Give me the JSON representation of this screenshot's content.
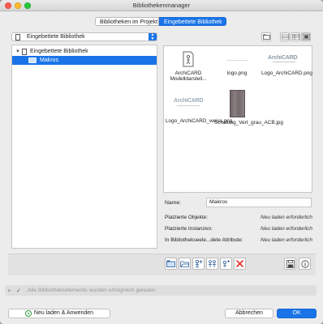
{
  "window": {
    "title": "Bibliothekenmanager"
  },
  "tabs": [
    {
      "label": "Bibliotheken im Projekt",
      "active": false
    },
    {
      "label": "Eingebettete Bibliothek",
      "active": true
    }
  ],
  "library_select": {
    "value": "Eingebettete Bibliothek"
  },
  "tree": {
    "items": [
      {
        "label": "Eingebettete Bibliothek",
        "expanded": true,
        "selected": false
      },
      {
        "label": "Makros",
        "selected": true
      }
    ]
  },
  "files": [
    {
      "label": "ArchiCARD Modelldarstell...",
      "icon": "gsm-object-icon"
    },
    {
      "label": "logo.png",
      "icon": "image-thumbnail"
    },
    {
      "label": "Logo_ArchiCARD.png",
      "icon": "image-thumbnail",
      "brand_text": "ArchiCARD"
    },
    {
      "label": "Logo_ArchiCARD_weiss.png",
      "icon": "image-thumbnail",
      "brand_text": "ArchiCARD"
    },
    {
      "label": "Schalung_Vert_grau_ACB.jpg",
      "icon": "texture-thumbnail"
    }
  ],
  "properties": {
    "name_label": "Name:",
    "name_value": "Makros",
    "rows": [
      {
        "key": "Platzierte Objekte:",
        "value": "Neu laden erforderlich"
      },
      {
        "key": "Platzierte Instanzen:",
        "value": "Neu laden erforderlich"
      },
      {
        "key": "In Bibliothekseele...dete Attribute:",
        "value": "Neu laden erforderlich"
      }
    ]
  },
  "status": {
    "message": "Alle Bibliothekselemente wurden erfolgreich geladen"
  },
  "buttons": {
    "reload": "Neu laden & Anwenden",
    "cancel": "Abbrechen",
    "ok": "OK"
  },
  "colors": {
    "accent": "#1a74e8",
    "delete": "#e0302b",
    "reload_green": "#2f9a3d"
  }
}
